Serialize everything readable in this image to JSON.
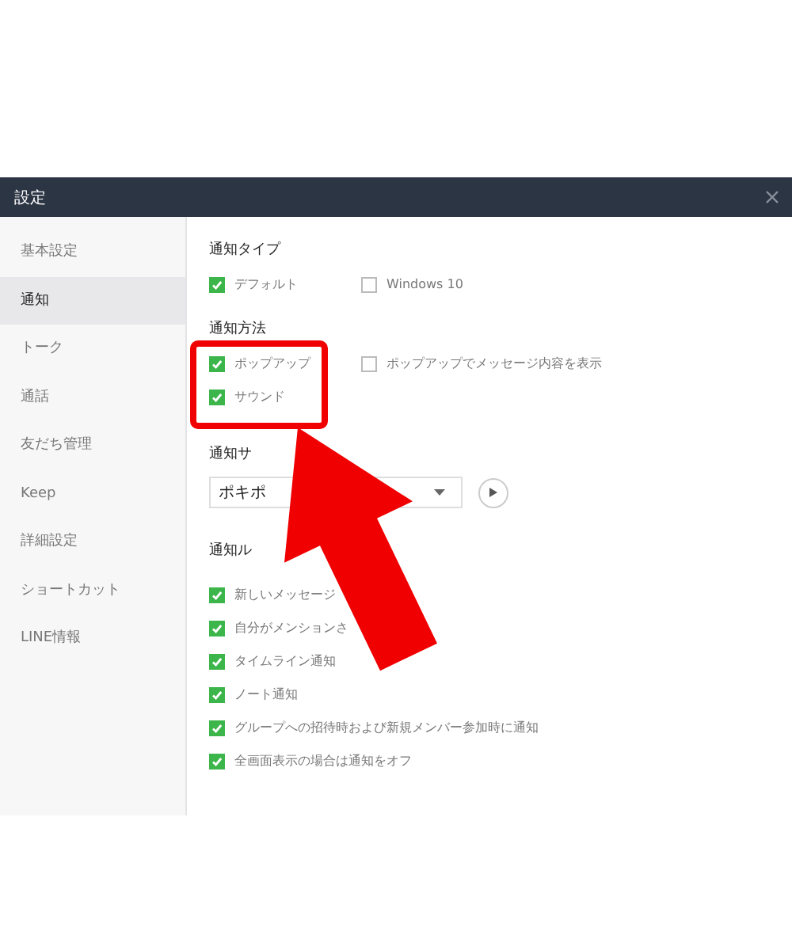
{
  "window": {
    "title": "設定"
  },
  "sidebar": {
    "items": [
      {
        "label": "基本設定",
        "selected": false
      },
      {
        "label": "通知",
        "selected": true
      },
      {
        "label": "トーク",
        "selected": false
      },
      {
        "label": "通話",
        "selected": false
      },
      {
        "label": "友だち管理",
        "selected": false
      },
      {
        "label": "Keep",
        "selected": false
      },
      {
        "label": "詳細設定",
        "selected": false
      },
      {
        "label": "ショートカット",
        "selected": false
      },
      {
        "label": "LINE情報",
        "selected": false
      }
    ]
  },
  "sections": [
    {
      "kind": "checks",
      "title": "通知タイプ",
      "options": [
        {
          "label": "デフォルト",
          "checked": true
        },
        {
          "label": "Windows 10",
          "checked": false
        }
      ]
    },
    {
      "kind": "checks",
      "title": "通知方法",
      "options": [
        {
          "label": "ポップアップ",
          "checked": true
        },
        {
          "label": "ポップアップでメッセージ内容を表示",
          "checked": false
        },
        {
          "label": "サウンド",
          "checked": true
        }
      ]
    },
    {
      "kind": "sound",
      "title": "通知サ",
      "value": "ポキポ"
    },
    {
      "kind": "list",
      "title": "通知ル",
      "options": [
        {
          "label": "新しいメッセージ",
          "checked": true
        },
        {
          "label": "自分がメンションさ",
          "checked": true
        },
        {
          "label": "タイムライン通知",
          "checked": true
        },
        {
          "label": "ノート通知",
          "checked": true
        },
        {
          "label": "グループへの招待時および新規メンバー参加時に通知",
          "checked": true
        },
        {
          "label": "全画面表示の場合は通知をオフ",
          "checked": true
        }
      ]
    }
  ]
}
